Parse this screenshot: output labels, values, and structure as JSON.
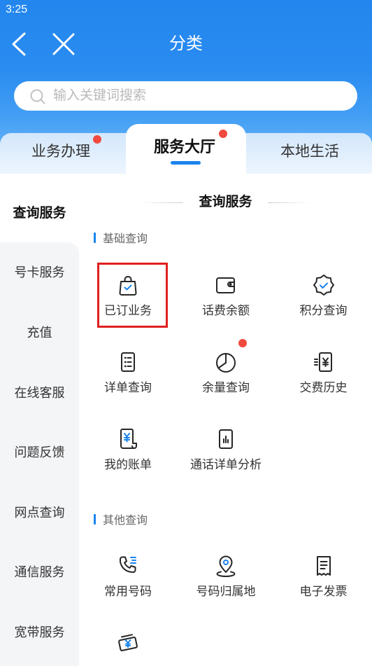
{
  "status_bar": {
    "time": "3:25"
  },
  "header": {
    "title": "分类",
    "back_icon": "back-icon",
    "close_icon": "close-icon"
  },
  "search": {
    "placeholder": "输入关键词搜索",
    "icon": "search-icon"
  },
  "tabs": [
    {
      "label": "业务办理",
      "active": false,
      "badge_dot": true
    },
    {
      "label": "服务大厅",
      "active": true,
      "badge_dot": true
    },
    {
      "label": "本地生活",
      "active": false,
      "badge_dot": false
    }
  ],
  "sidebar": {
    "items": [
      {
        "label": "查询服务",
        "active": true
      },
      {
        "label": "号卡服务",
        "active": false
      },
      {
        "label": "充值",
        "active": false
      },
      {
        "label": "在线客服",
        "active": false
      },
      {
        "label": "问题反馈",
        "active": false
      },
      {
        "label": "网点查询",
        "active": false
      },
      {
        "label": "通信服务",
        "active": false
      },
      {
        "label": "宽带服务",
        "active": false
      }
    ]
  },
  "section": {
    "title": "查询服务",
    "groups": [
      {
        "title": "基础查询",
        "items": [
          {
            "label": "已订业务",
            "icon": "shopping-bag-check-icon",
            "highlighted": true
          },
          {
            "label": "话费余额",
            "icon": "wallet-icon"
          },
          {
            "label": "积分查询",
            "icon": "badge-check-icon"
          },
          {
            "label": "详单查询",
            "icon": "list-document-icon"
          },
          {
            "label": "余量查询",
            "icon": "pie-chart-icon",
            "badge_dot": true
          },
          {
            "label": "交费历史",
            "icon": "yuan-receipt-icon"
          },
          {
            "label": "我的账单",
            "icon": "yuan-bill-icon"
          },
          {
            "label": "通话详单分析",
            "icon": "bar-chart-document-icon"
          }
        ]
      },
      {
        "title": "其他查询",
        "items": [
          {
            "label": "常用号码",
            "icon": "phone-icon"
          },
          {
            "label": "号码归属地",
            "icon": "location-pin-icon"
          },
          {
            "label": "电子发票",
            "icon": "invoice-icon"
          },
          {
            "icon": "yuan-ticket-icon"
          }
        ]
      }
    ]
  },
  "colors": {
    "header_blue": "#2286ee",
    "accent": "#1a84ee",
    "badge_dot": "#f04a3e",
    "highlight_border": "#e02020",
    "sidebar_bg": "#f4f5f7"
  }
}
